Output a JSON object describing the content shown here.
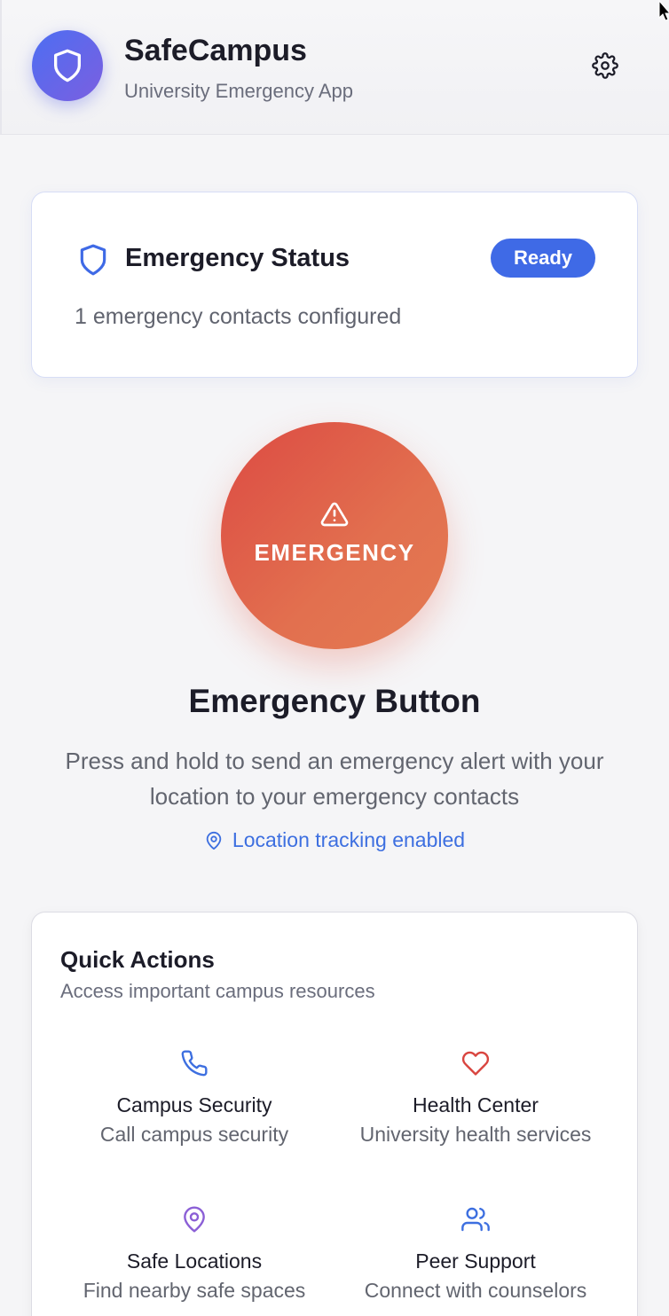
{
  "header": {
    "title": "SafeCampus",
    "subtitle": "University Emergency App"
  },
  "status_card": {
    "title": "Emergency Status",
    "badge": "Ready",
    "contacts_text": "1 emergency contacts configured"
  },
  "emergency": {
    "button_label": "EMERGENCY",
    "heading": "Emergency Button",
    "description": "Press and hold to send an emergency alert with your location to your emergency contacts",
    "location_status": "Location tracking enabled"
  },
  "quick_actions": {
    "title": "Quick Actions",
    "subtitle": "Access important campus resources",
    "items": [
      {
        "label": "Campus Security",
        "description": "Call campus security",
        "icon": "phone-icon",
        "color": "#3d6fe0"
      },
      {
        "label": "Health Center",
        "description": "University health services",
        "icon": "heart-icon",
        "color": "#d9453f"
      },
      {
        "label": "Safe Locations",
        "description": "Find nearby safe spaces",
        "icon": "map-pin-icon",
        "color": "#8b5fd6"
      },
      {
        "label": "Peer Support",
        "description": "Connect with counselors",
        "icon": "users-icon",
        "color": "#3d6fe0"
      }
    ]
  },
  "colors": {
    "accent": "#3f6ae6",
    "emergency_start": "#dc4a43",
    "emergency_end": "#e47a52",
    "logo_start": "#4d6ef2",
    "logo_end": "#7b5fe0"
  }
}
